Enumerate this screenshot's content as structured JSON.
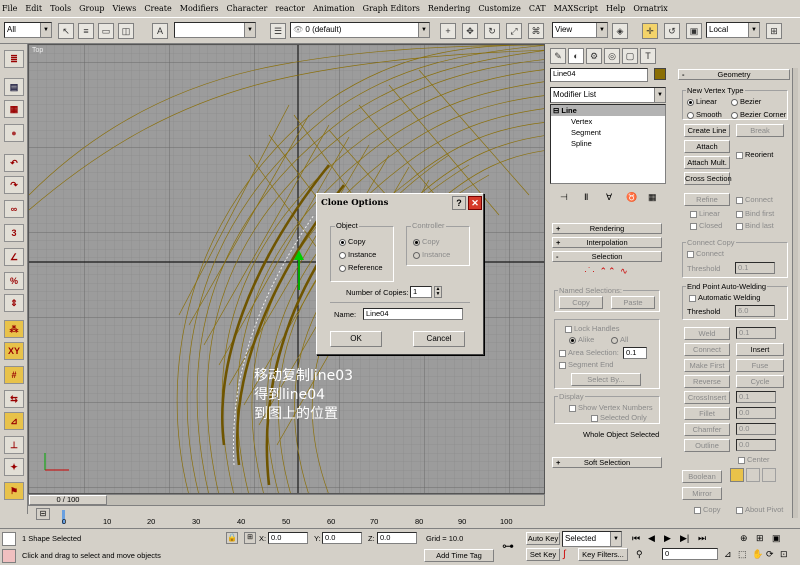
{
  "menu": [
    "File",
    "Edit",
    "Tools",
    "Group",
    "Views",
    "Create",
    "Modifiers",
    "Character",
    "reactor",
    "Animation",
    "Graph Editors",
    "Rendering",
    "Customize",
    "CAT",
    "MAXScript",
    "Help",
    "Ornatrix"
  ],
  "toolbar": {
    "selection_filter": "All",
    "layer": "0 (default)",
    "view_dropdown": "View",
    "coord_dropdown": "Local"
  },
  "viewport": {
    "label": "Top",
    "annotation_line1": "移动复制line03",
    "annotation_line2": "得到line04",
    "annotation_line3": "到图上的位置"
  },
  "dialog": {
    "title": "Clone Options",
    "object_group": "Object",
    "controller_group": "Controller",
    "copy_label": "Copy",
    "instance_label": "Instance",
    "reference_label": "Reference",
    "ctrl_copy_label": "Copy",
    "ctrl_instance_label": "Instance",
    "copies_label": "Number of Copies:",
    "copies_value": "1",
    "name_label": "Name:",
    "name_value": "Line04",
    "ok_label": "OK",
    "cancel_label": "Cancel"
  },
  "command_panel": {
    "object_name": "Line04",
    "modifier_list": "Modifier List",
    "stack": [
      "Line",
      "Vertex",
      "Segment",
      "Spline"
    ],
    "rollouts": {
      "rendering": "Rendering",
      "interpolation": "Interpolation",
      "selection": "Selection",
      "soft_selection": "Soft Selection",
      "geometry": "Geometry"
    },
    "named_selections": "Named Selections:",
    "ns_copy": "Copy",
    "ns_paste": "Paste",
    "lock_handles": "Lock Handles",
    "alike": "Alike",
    "all": "All",
    "area_selection": "Area Selection:",
    "area_value": "0.1",
    "segment_end": "Segment End",
    "select_by": "Select By...",
    "display_group": "Display",
    "show_vertex_numbers": "Show Vertex Numbers",
    "selected_only": "Selected Only",
    "whole_object": "Whole Object Selected",
    "new_vertex_type": "New Vertex Type",
    "linear": "Linear",
    "bezier": "Bezier",
    "smooth": "Smooth",
    "bezier_corner": "Bezier Corner",
    "create_line": "Create Line",
    "break": "Break",
    "attach": "Attach",
    "attach_mult": "Attach Mult.",
    "reorient": "Reorient",
    "cross_section": "Cross Section",
    "refine": "Refine",
    "connect": "Connect",
    "linear2": "Linear",
    "bind_first": "Bind first",
    "closed": "Closed",
    "bind_last": "Bind last",
    "connect_copy": "Connect Copy",
    "connect2": "Connect",
    "threshold": "Threshold",
    "threshold_value": "0.1",
    "endpoint_welding": "End Point Auto-Welding",
    "automatic_welding": "Automatic Welding",
    "threshold2": "Threshold",
    "threshold2_value": "6.0",
    "weld": "Weld",
    "weld_value": "0.1",
    "connect3": "Connect",
    "insert": "Insert",
    "make_first": "Make First",
    "fuse": "Fuse",
    "reverse": "Reverse",
    "cycle": "Cycle",
    "crossinsert": "CrossInsert",
    "crossinsert_value": "0.1",
    "fillet": "Fillet",
    "fillet_value": "0.0",
    "chamfer": "Chamfer",
    "chamfer_value": "0.0",
    "outline": "Outline",
    "outline_value": "0.0",
    "center": "Center",
    "boolean": "Boolean",
    "mirror": "Mirror",
    "copy": "Copy",
    "about_pivot": "About Pivot"
  },
  "timeline": {
    "frame_label": "0 / 100",
    "ticks": [
      "0",
      "10",
      "20",
      "30",
      "40",
      "50",
      "60",
      "70",
      "80",
      "90",
      "100"
    ]
  },
  "status": {
    "selection": "1 Shape Selected",
    "prompt": "Click and drag to select and move objects",
    "x_label": "X:",
    "x_value": "0.0",
    "y_label": "Y:",
    "y_value": "0.0",
    "z_label": "Z:",
    "z_value": "0.0",
    "grid": "Grid = 10.0",
    "add_time_tag": "Add Time Tag",
    "auto_key": "Auto Key",
    "key_mode": "Selected",
    "set_key": "Set Key",
    "key_filters": "Key Filters...",
    "frame": "0"
  }
}
